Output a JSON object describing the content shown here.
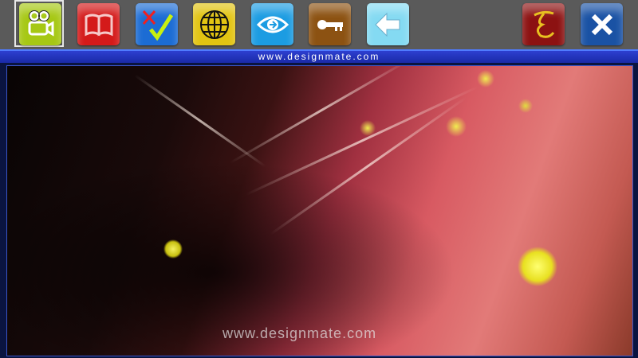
{
  "toolbar": {
    "buttons": [
      {
        "name": "video",
        "color": "#a8cc10"
      },
      {
        "name": "book",
        "color": "#d01818"
      },
      {
        "name": "quiz",
        "color": "#1a6ad0"
      },
      {
        "name": "globe",
        "color": "#e0c010"
      },
      {
        "name": "view",
        "color": "#1a9ae0"
      },
      {
        "name": "key",
        "color": "#8a5010"
      },
      {
        "name": "back",
        "color": "#80d8f0"
      },
      {
        "name": "logo",
        "color": "#8a1010"
      },
      {
        "name": "close",
        "color": "#1a50a0"
      }
    ]
  },
  "header": {
    "url": "www.designmate.com"
  },
  "video": {
    "watermark": "www.designmate.com"
  }
}
